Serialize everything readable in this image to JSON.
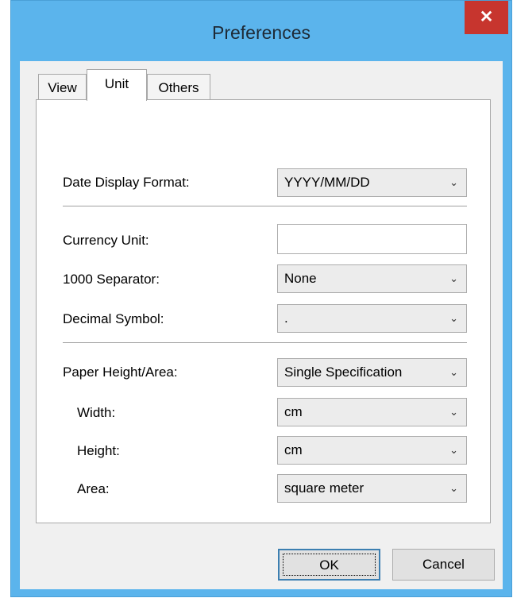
{
  "window": {
    "title": "Preferences",
    "close_glyph": "✕"
  },
  "tabs": [
    {
      "label": "View",
      "active": false
    },
    {
      "label": "Unit",
      "active": true
    },
    {
      "label": "Others",
      "active": false
    }
  ],
  "form": {
    "date_display_format": {
      "label": "Date Display Format:",
      "value": "YYYY/MM/DD"
    },
    "currency_unit": {
      "label": "Currency Unit:",
      "value": ""
    },
    "thousand_separator": {
      "label": "1000 Separator:",
      "value": "None"
    },
    "decimal_symbol": {
      "label": "Decimal Symbol:",
      "value": "."
    },
    "paper_height_area": {
      "label": "Paper Height/Area:",
      "value": "Single Specification"
    },
    "width": {
      "label": "Width:",
      "value": "cm"
    },
    "height": {
      "label": "Height:",
      "value": "cm"
    },
    "area": {
      "label": "Area:",
      "value": "square meter"
    }
  },
  "buttons": {
    "ok": "OK",
    "cancel": "Cancel"
  },
  "icons": {
    "dropdown": "chevron-down-icon",
    "close": "close-icon"
  },
  "colors": {
    "title_bar": "#5bb4ec",
    "close_button": "#c7352e",
    "client_bg": "#f0f0f0"
  }
}
